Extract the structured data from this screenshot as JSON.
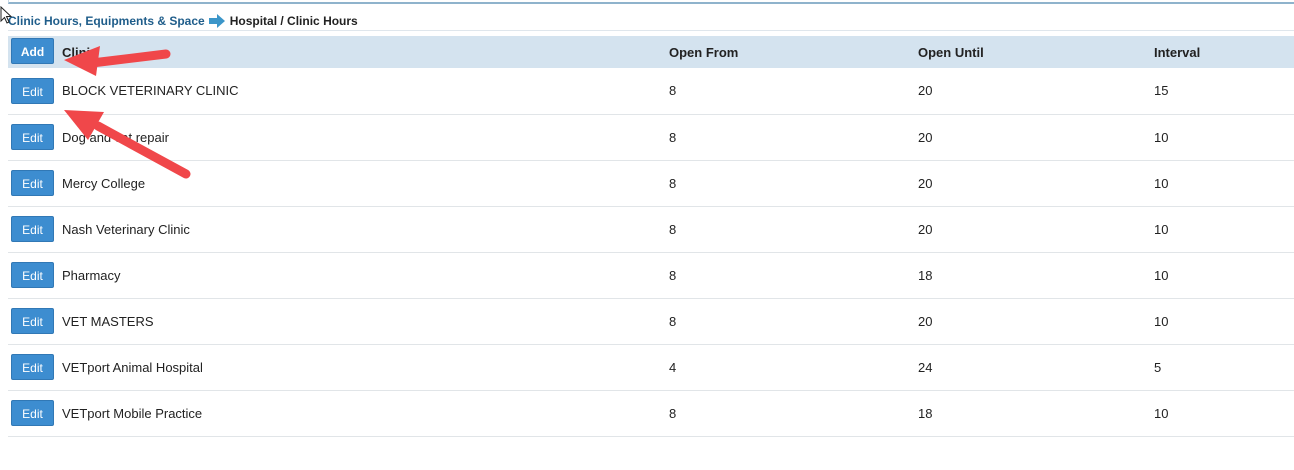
{
  "breadcrumb": {
    "parent": "Clinic Hours, Equipments & Space",
    "current": "Hospital / Clinic Hours"
  },
  "table": {
    "add_label": "Add",
    "edit_label": "Edit",
    "headers": {
      "clinic": "Clinic",
      "open_from": "Open From",
      "open_until": "Open Until",
      "interval": "Interval"
    },
    "rows": [
      {
        "clinic": "BLOCK VETERINARY CLINIC",
        "open_from": "8",
        "open_until": "20",
        "interval": "15"
      },
      {
        "clinic": "Dog and cat repair",
        "open_from": "8",
        "open_until": "20",
        "interval": "10"
      },
      {
        "clinic": "Mercy College",
        "open_from": "8",
        "open_until": "20",
        "interval": "10"
      },
      {
        "clinic": "Nash Veterinary Clinic",
        "open_from": "8",
        "open_until": "20",
        "interval": "10"
      },
      {
        "clinic": "Pharmacy",
        "open_from": "8",
        "open_until": "18",
        "interval": "10"
      },
      {
        "clinic": "VET MASTERS",
        "open_from": "8",
        "open_until": "20",
        "interval": "10"
      },
      {
        "clinic": "VETport Animal Hospital",
        "open_from": "4",
        "open_until": "24",
        "interval": "5"
      },
      {
        "clinic": "VETport Mobile Practice",
        "open_from": "8",
        "open_until": "18",
        "interval": "10"
      }
    ]
  },
  "colors": {
    "button": "#3d8dd0",
    "header_bg": "#d4e3ef",
    "breadcrumb_link": "#1f5d8a",
    "annotation_arrow": "#f0474a"
  }
}
